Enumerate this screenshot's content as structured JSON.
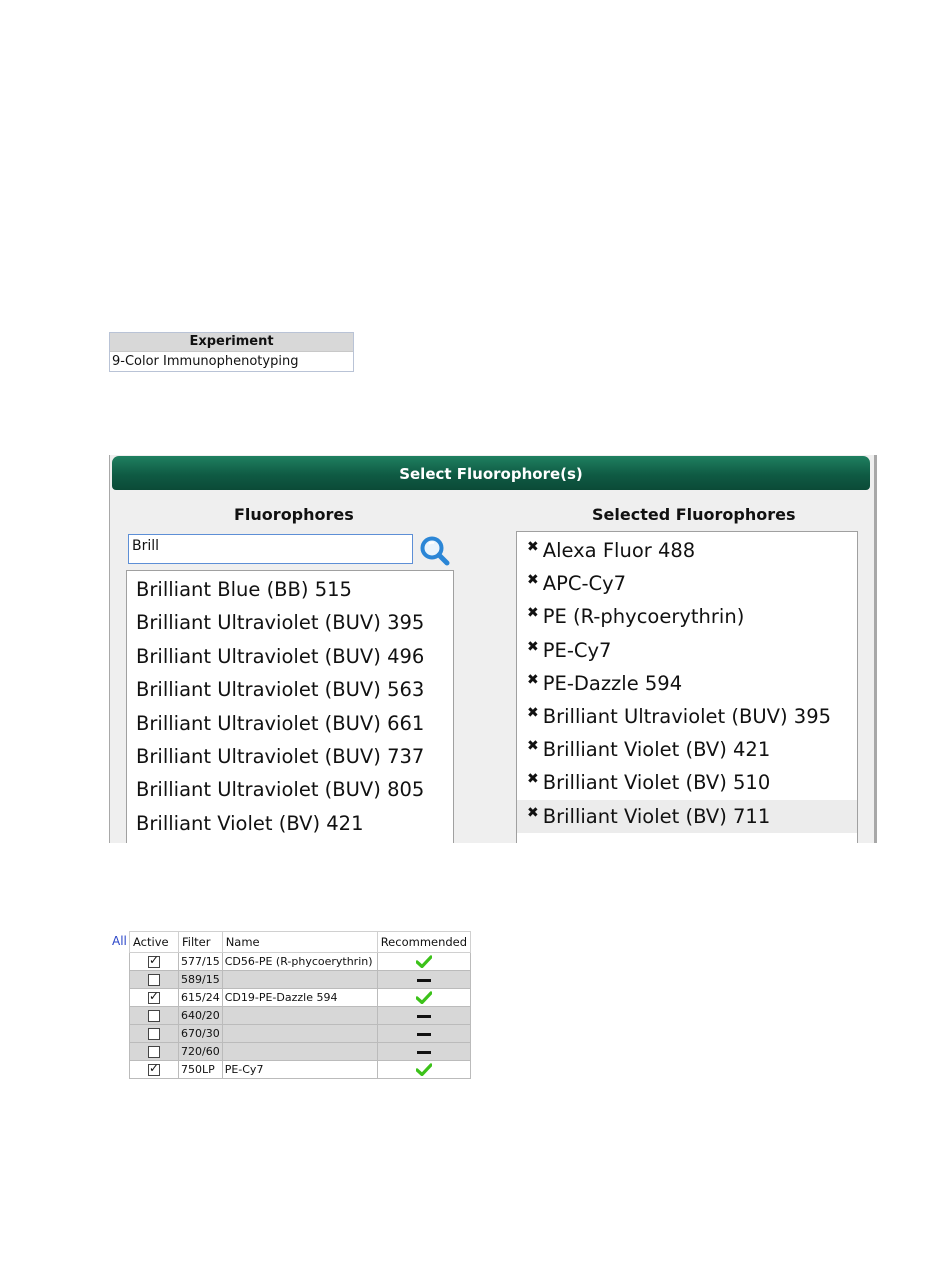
{
  "experiment": {
    "header": "Experiment",
    "value": "9-Color Immunophenotyping"
  },
  "fluorophore_panel": {
    "title": "Select Fluorophore(s)",
    "left_title": "Fluorophores",
    "right_title": "Selected Fluorophores",
    "search": {
      "value": "Brill",
      "icon": "search-icon"
    },
    "available": [
      "Brilliant Blue (BB) 515",
      "Brilliant Ultraviolet (BUV) 395",
      "Brilliant Ultraviolet (BUV) 496",
      "Brilliant Ultraviolet (BUV) 563",
      "Brilliant Ultraviolet (BUV) 661",
      "Brilliant Ultraviolet (BUV) 737",
      "Brilliant Ultraviolet (BUV) 805",
      "Brilliant Violet (BV) 421"
    ],
    "selected": [
      "Alexa Fluor 488",
      "APC-Cy7",
      "PE (R-phycoerythrin)",
      "PE-Cy7",
      "PE-Dazzle 594",
      "Brilliant Ultraviolet (BUV) 395",
      "Brilliant Violet (BV) 421",
      "Brilliant Violet (BV) 510",
      "Brilliant Violet (BV) 711"
    ],
    "remove_glyph": "✖",
    "header_color": "#0f5b44"
  },
  "filter_table": {
    "all_link": "All",
    "columns": [
      "Active",
      "Filter",
      "Name",
      "Recommended"
    ],
    "rows": [
      {
        "active": true,
        "filter": "577/15",
        "name": "CD56-PE (R-phycoerythrin)",
        "recommended": "check"
      },
      {
        "active": false,
        "filter": "589/15",
        "name": "",
        "recommended": "dash"
      },
      {
        "active": true,
        "filter": "615/24",
        "name": "CD19-PE-Dazzle 594",
        "recommended": "check"
      },
      {
        "active": false,
        "filter": "640/20",
        "name": "",
        "recommended": "dash"
      },
      {
        "active": false,
        "filter": "670/30",
        "name": "",
        "recommended": "dash"
      },
      {
        "active": false,
        "filter": "720/60",
        "name": "",
        "recommended": "dash"
      },
      {
        "active": true,
        "filter": "750LP",
        "name": "PE-Cy7",
        "recommended": "check"
      }
    ],
    "check_color": "#3cc21a"
  }
}
